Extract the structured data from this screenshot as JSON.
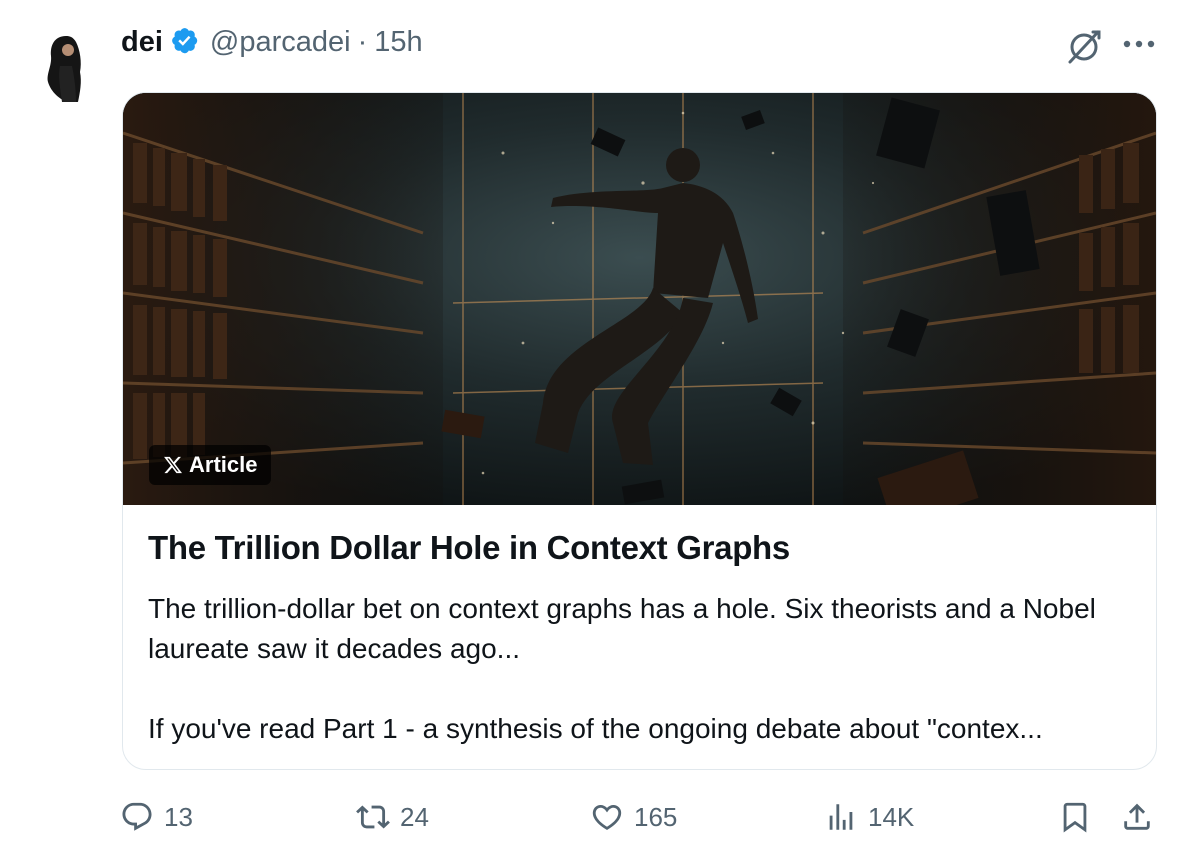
{
  "tweet": {
    "author_name": "dei",
    "handle": "@parcadei",
    "separator": "·",
    "time": "15h",
    "verified": true
  },
  "article": {
    "badge_label": "Article",
    "title": "The Trillion Dollar Hole in Context Graphs",
    "description_line1": "The trillion-dollar bet on context graphs has a hole. Six theorists and a Nobel laureate saw it decades ago...",
    "description_line2": "If you've read Part 1 - a synthesis of the ongoing debate about \"contex..."
  },
  "actions": {
    "replies": "13",
    "reposts": "24",
    "likes": "165",
    "views": "14K"
  },
  "icons": {
    "verified": "verified-badge-icon",
    "grok": "grok-icon",
    "more": "more-icon",
    "reply": "reply-icon",
    "repost": "repost-icon",
    "like": "heart-icon",
    "views": "views-icon",
    "bookmark": "bookmark-icon",
    "share": "share-icon"
  },
  "colors": {
    "text": "#0f1419",
    "secondary": "#536471",
    "verified": "#1d9bf0"
  }
}
